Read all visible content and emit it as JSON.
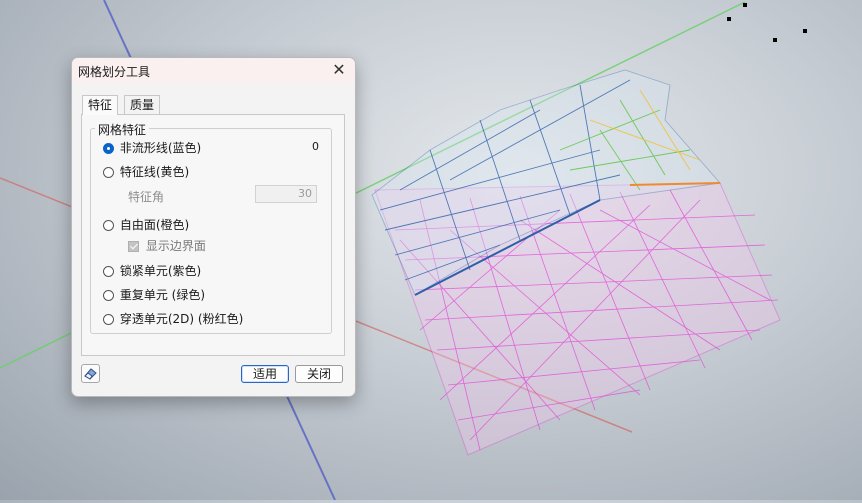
{
  "dialog": {
    "title": "网格划分工具",
    "close_icon": "close-icon",
    "tabs": [
      {
        "label": "特征",
        "active": true
      },
      {
        "label": "质量",
        "active": false
      }
    ],
    "group": {
      "legend": "网格特征",
      "options": [
        {
          "label": "非流形线(蓝色)",
          "checked": true
        },
        {
          "label": "特征线(黄色)",
          "checked": false
        },
        {
          "label": "自由面(橙色)",
          "checked": false
        },
        {
          "label": "锁紧单元(紫色)",
          "checked": false
        },
        {
          "label": "重复单元 (绿色)",
          "checked": false
        },
        {
          "label": "穿透单元(2D) (粉红色)",
          "checked": false
        }
      ],
      "count_value": "0",
      "feature_angle": {
        "label": "特征角",
        "value": "30"
      },
      "show_boundary": {
        "label": "显示边界面",
        "checked": true,
        "disabled": true
      }
    },
    "buttons": {
      "apply": "适用",
      "close": "关闭"
    },
    "eraser_icon": "eraser-icon"
  },
  "colors": {
    "accent": "#0a63c7",
    "mesh_pink": "#e23bd6",
    "mesh_blue": "#2e5fa8",
    "mesh_green": "#5cc445",
    "mesh_orange": "#f08a2c"
  }
}
